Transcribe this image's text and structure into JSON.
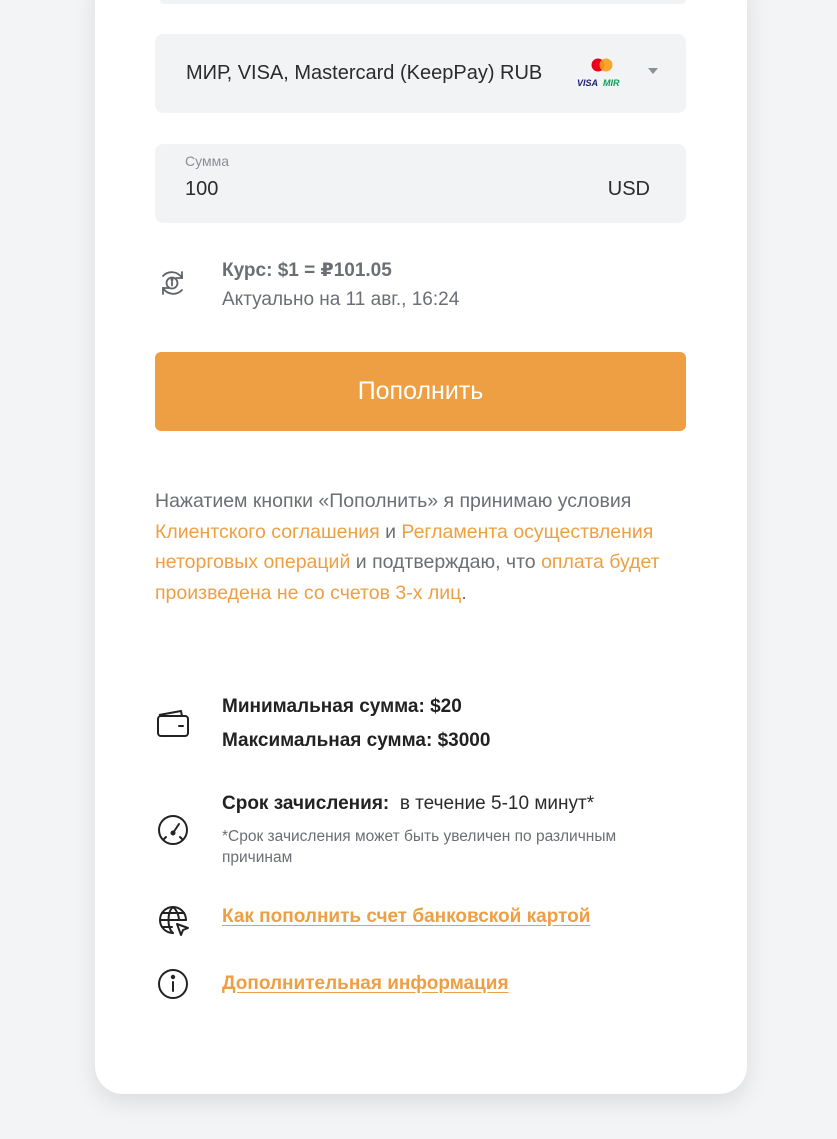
{
  "payment_method": {
    "label": "МИР, VISA, Mastercard (KeepPay) RUB",
    "logo_text_visa": "VISA",
    "logo_text_mir": "MIR"
  },
  "amount": {
    "label": "Сумма",
    "value": "100",
    "currency": "USD"
  },
  "rate": {
    "title": "Курс: $1 = ₽101.05",
    "updated": "Актуально на 11 авг., 16:24"
  },
  "submit": {
    "label": "Пополнить"
  },
  "terms": {
    "part1": "Нажатием кнопки «Пополнить» я принимаю условия ",
    "link1": "Клиентского соглашения",
    "part2": " и ",
    "link2": "Регламента осуществления неторговых операций",
    "part3": " и подтверждаю, что ",
    "link3": "оплата будет произведена не со счетов 3-х лиц",
    "part4": "."
  },
  "limits": {
    "min": "Минимальная сумма: $20",
    "max": "Максимальная сумма: $3000"
  },
  "crediting": {
    "label": "Срок зачисления:",
    "value": "в течение 5-10 минут*",
    "note": "*Срок зачисления может быть увеличен по различным причинам"
  },
  "links": {
    "how_to": "Как пополнить счет банковской картой",
    "more_info": "Дополнительная информация"
  },
  "colors": {
    "accent": "#ee9f43",
    "field_bg": "#f2f3f5",
    "text_secondary": "#6b6e74"
  }
}
